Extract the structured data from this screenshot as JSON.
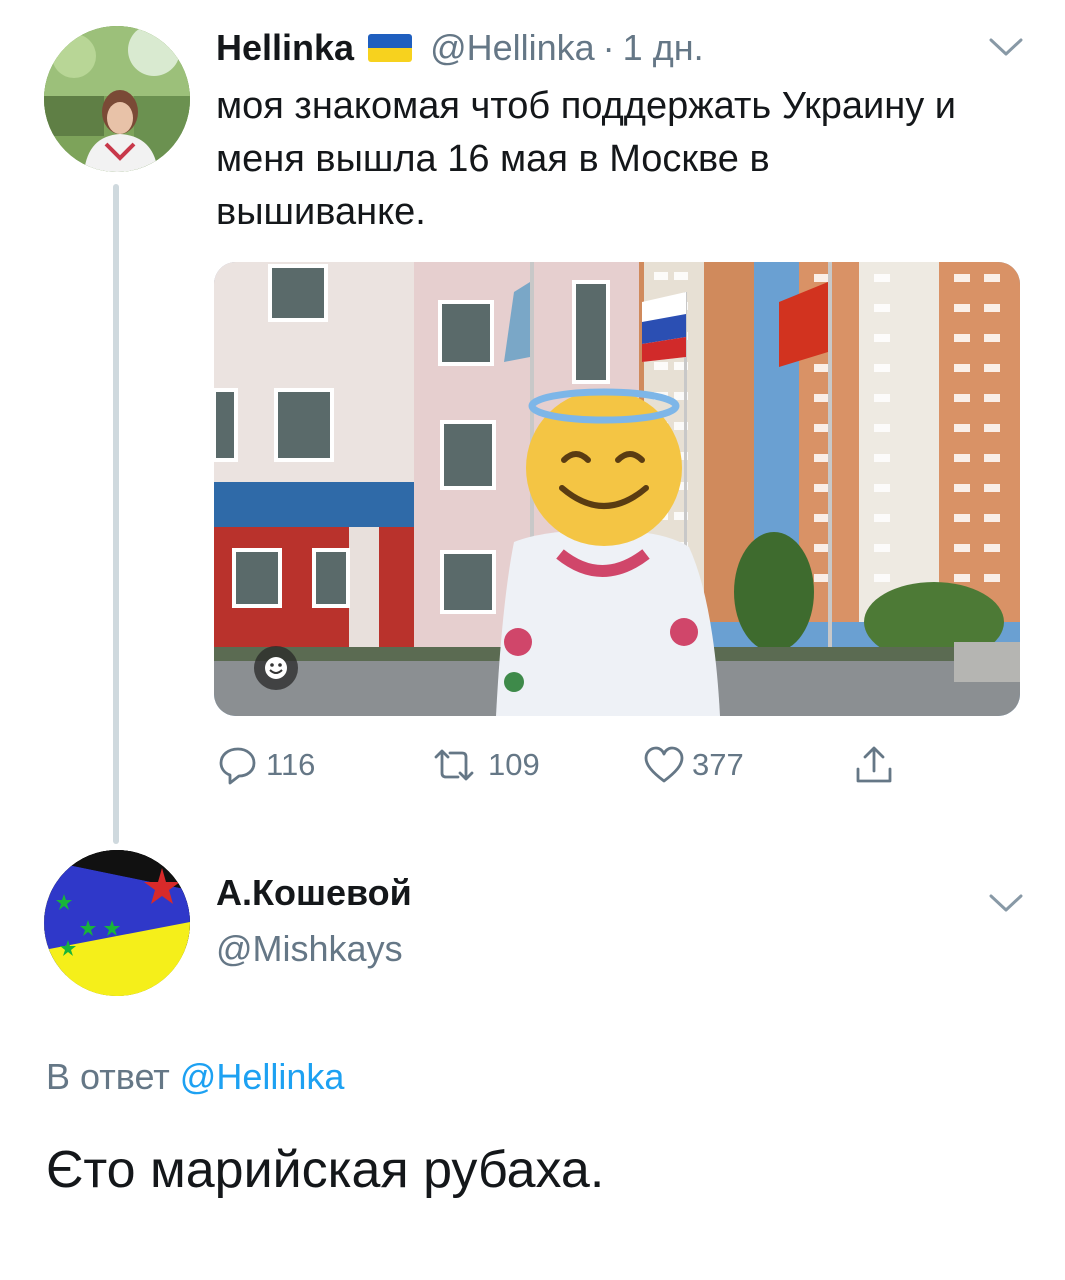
{
  "tweet": {
    "display_name": "Hellinka",
    "handle": "@Hellinka",
    "separator": "·",
    "time": "1 дн.",
    "text": "моя знакомая  чтоб поддержать Украину и меня вышла 16 мая в Москве в вышиванке.",
    "stats": {
      "replies": "116",
      "retweets": "109",
      "likes": "377"
    },
    "flag_colors": {
      "top": "#1f5fbf",
      "bottom": "#f7d21e"
    }
  },
  "reply": {
    "display_name": "А.Кошевой",
    "handle": "@Mishkays",
    "in_reply_to_prefix": "В ответ",
    "in_reply_to_handle": "@Hellinka",
    "text": "Єто марийская рубаха."
  },
  "colors": {
    "text": "#14171a",
    "secondary": "#657786",
    "accent": "#1da1f2",
    "thread_line": "#cfd9de"
  },
  "icons": [
    "reply-icon",
    "retweet-icon",
    "like-icon",
    "share-icon",
    "chevron-down-icon",
    "smiley-icon"
  ]
}
